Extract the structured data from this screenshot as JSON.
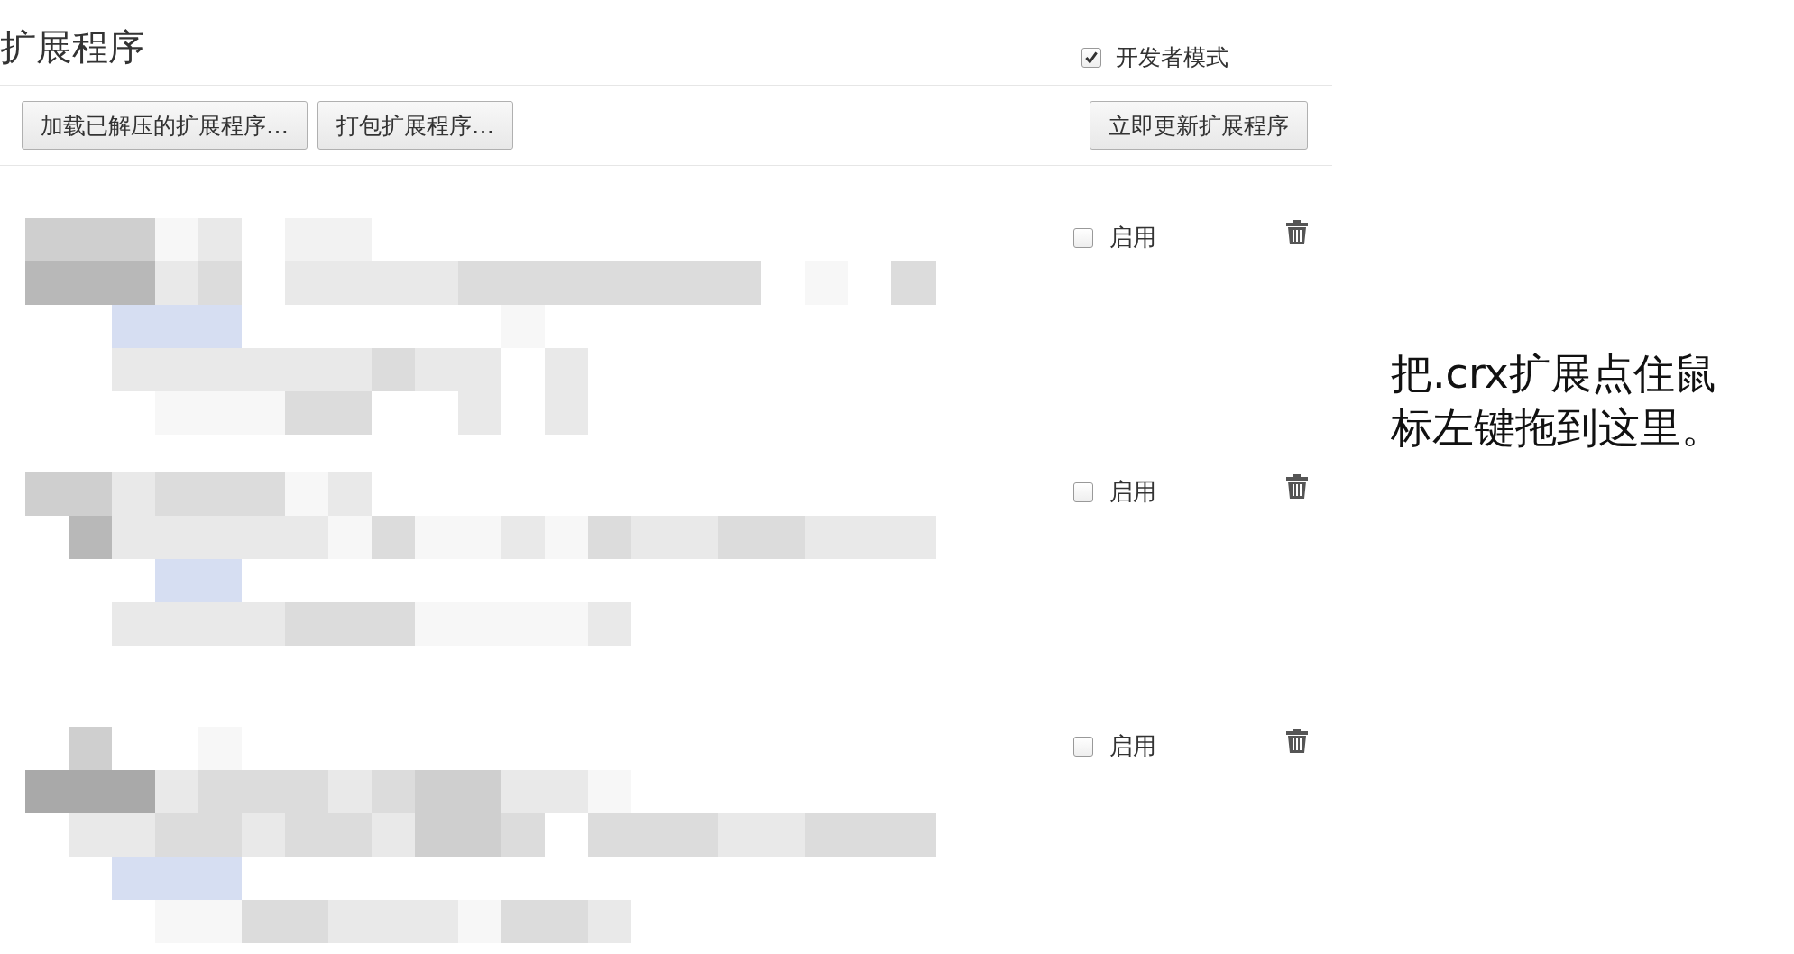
{
  "page_title": "扩展程序",
  "developer_mode": {
    "label": "开发者模式",
    "checked": true
  },
  "buttons": [
    "加载已解压的扩展程序…",
    "打包扩展程序…",
    "立即更新扩展程序"
  ],
  "extensions": [
    {
      "enable_label": "启用",
      "enabled": false
    },
    {
      "enable_label": "启用",
      "enabled": false
    },
    {
      "enable_label": "启用",
      "enabled": false
    }
  ],
  "drop_hint": {
    "lines": [
      "把.crx扩展点住鼠",
      "标左键拖到这里。"
    ]
  }
}
